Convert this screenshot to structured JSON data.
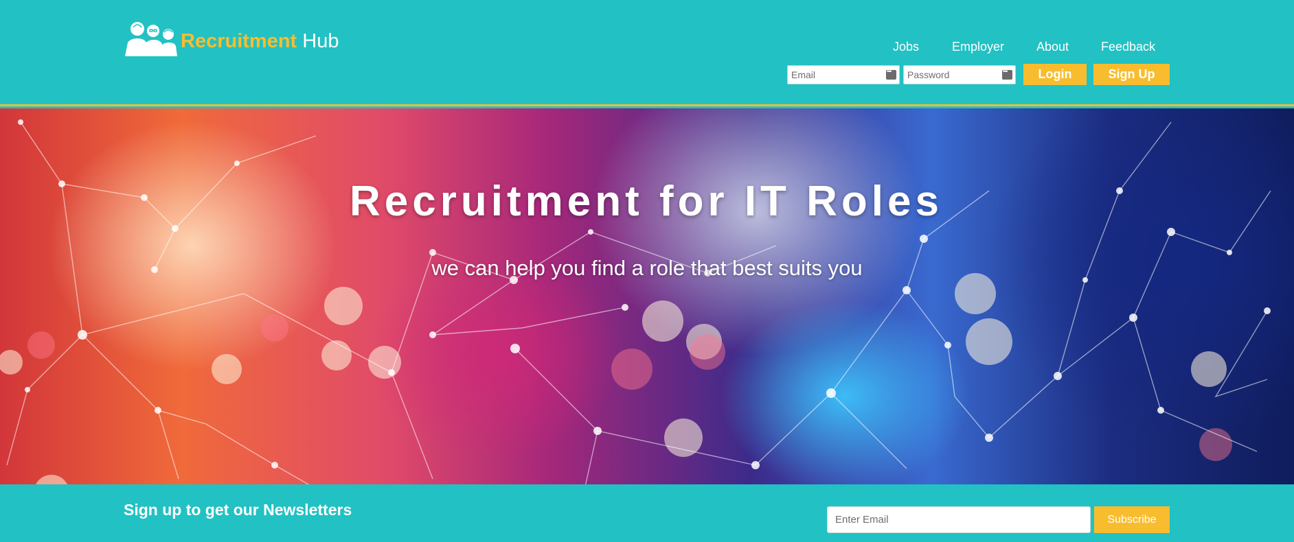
{
  "header": {
    "logo": {
      "brand": "Recruitment",
      "suffix": "Hub",
      "icon": "people-group-icon"
    },
    "nav": [
      "Jobs",
      "Employer",
      "About",
      "Feedback"
    ],
    "login": {
      "email_placeholder": "Email",
      "password_placeholder": "Password",
      "login_label": "Login",
      "signup_label": "Sign Up"
    }
  },
  "hero": {
    "title": "Recruitment for IT Roles",
    "subtitle": "we can help you find a role that best suits you"
  },
  "newsletter": {
    "title": "Sign up to get our Newsletters",
    "email_placeholder": "Enter Email",
    "button_label": "Subscribe"
  },
  "colors": {
    "primary": "#22c1c3",
    "accent": "#f8bd2f",
    "text_light": "#ffffff"
  }
}
